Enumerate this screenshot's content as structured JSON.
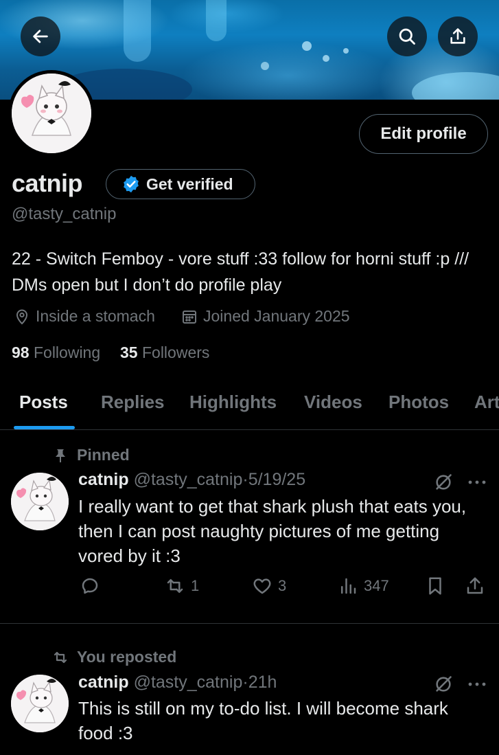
{
  "header": {
    "back_icon": "arrow-left-icon",
    "search_icon": "search-icon",
    "share_icon": "share-icon"
  },
  "profile": {
    "edit_label": "Edit profile",
    "name": "catnip",
    "get_verified_label": "Get verified",
    "handle": "@tasty_catnip",
    "bio": "22 - Switch Femboy - vore stuff :33 follow for horni stuff :p /// DMs open but I don’t do profile play",
    "location": "Inside a stomach",
    "joined": "Joined January 2025",
    "following_count": "98",
    "following_label": "Following",
    "followers_count": "35",
    "followers_label": "Followers"
  },
  "tabs": [
    "Posts",
    "Replies",
    "Highlights",
    "Videos",
    "Photos",
    "Art"
  ],
  "posts": [
    {
      "context": "Pinned",
      "name": "catnip",
      "handle": "@tasty_catnip",
      "dot": "·",
      "time": "5/19/25",
      "text": "I really want to get that shark plush that eats you, then I can post naughty pictures of me getting vored by it :3",
      "reposts": "1",
      "likes": "3",
      "views": "347"
    },
    {
      "context": "You reposted",
      "name": "catnip",
      "handle": "@tasty_catnip",
      "dot": "·",
      "time": "21h",
      "text": "This is still on my to-do list. I will become shark food :3"
    }
  ],
  "colors": {
    "background": "#000000",
    "text": "#e7e9ea",
    "muted": "#71767b",
    "accent": "#1d9bf0",
    "border": "#2f3336"
  }
}
